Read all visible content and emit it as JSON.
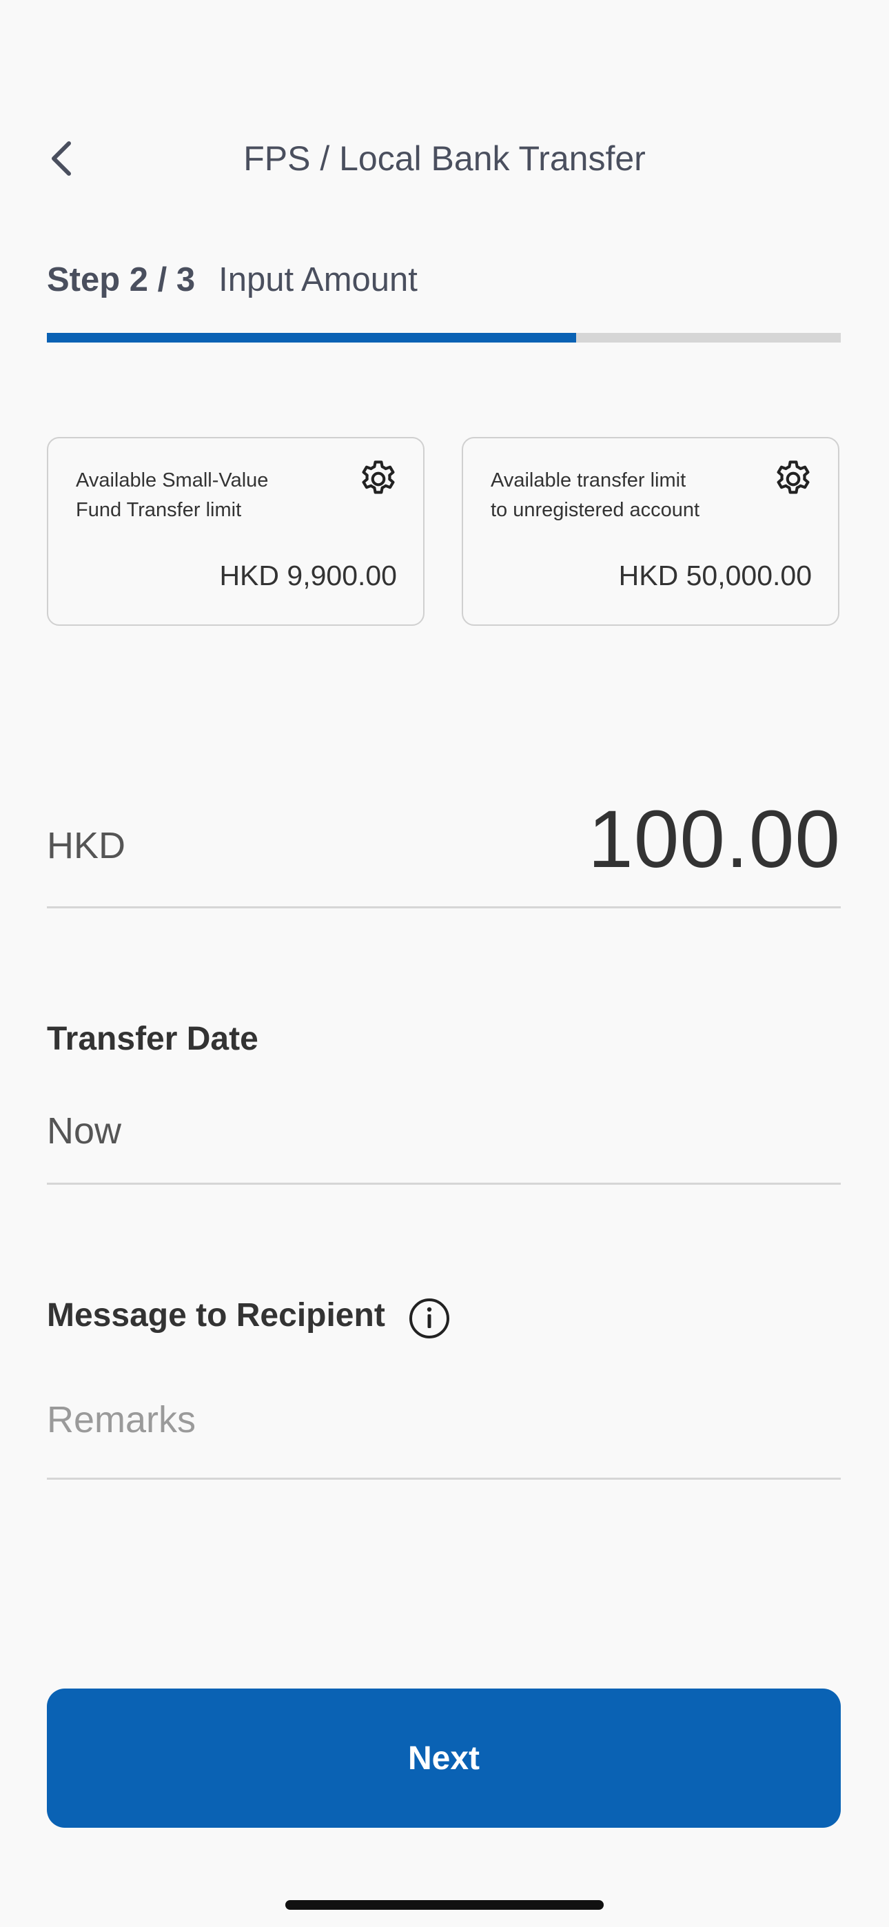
{
  "header": {
    "title": "FPS / Local Bank Transfer",
    "back_icon": "chevron-left-icon"
  },
  "step": {
    "number": "Step 2 / 3",
    "label": "Input Amount",
    "progress_fraction": 0.6667
  },
  "limits": [
    {
      "title": "Available Small-Value\nFund Transfer limit",
      "value": "HKD 9,900.00",
      "icon": "gear-icon"
    },
    {
      "title": "Available transfer limit\nto unregistered account",
      "value": "HKD 50,000.00",
      "icon": "gear-icon"
    }
  ],
  "amount": {
    "currency": "HKD",
    "value": "100.00"
  },
  "transfer_date": {
    "label": "Transfer Date",
    "value": "Now"
  },
  "message": {
    "label": "Message to Recipient",
    "info_icon": "info-icon",
    "placeholder": "Remarks",
    "value": ""
  },
  "actions": {
    "next_label": "Next"
  },
  "colors": {
    "accent": "#0a62b4",
    "progress_track": "#d6d6d6",
    "background": "#f9f9f9"
  }
}
